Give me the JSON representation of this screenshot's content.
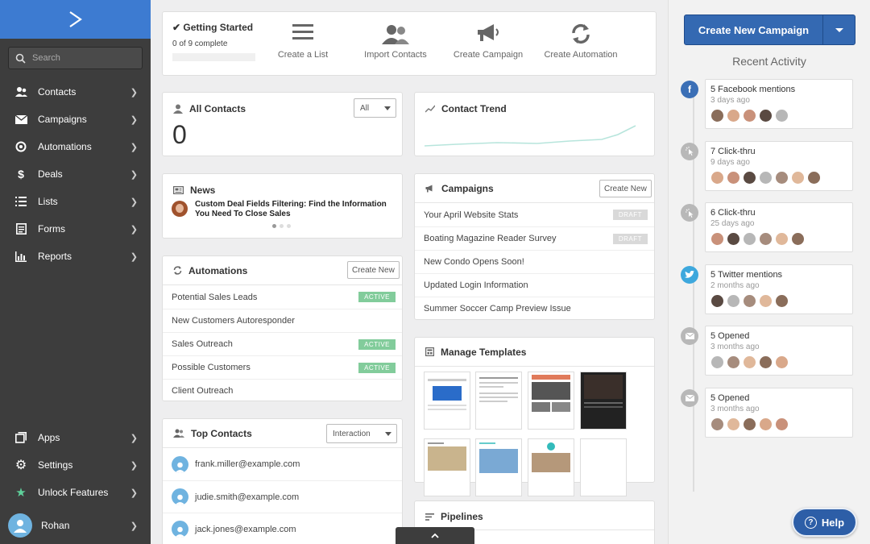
{
  "search": {
    "placeholder": "Search"
  },
  "nav": {
    "contacts": "Contacts",
    "campaigns": "Campaigns",
    "automations": "Automations",
    "deals": "Deals",
    "lists": "Lists",
    "forms": "Forms",
    "reports": "Reports",
    "apps": "Apps",
    "settings": "Settings",
    "unlock": "Unlock Features",
    "user": "Rohan"
  },
  "getting_started": {
    "title": "Getting Started",
    "progress_text": "0 of 9 complete",
    "progress": 0,
    "actions": [
      "Create a List",
      "Import Contacts",
      "Create Campaign",
      "Create Automation"
    ]
  },
  "all_contacts": {
    "title": "All Contacts",
    "filter": "All",
    "count": "0"
  },
  "contact_trend": {
    "title": "Contact Trend"
  },
  "news": {
    "title": "News",
    "headline": "Custom Deal Fields Filtering: Find the Information You Need To Close Sales"
  },
  "automations": {
    "title": "Automations",
    "create_label": "Create New",
    "items": [
      {
        "name": "Potential Sales Leads",
        "status": "ACTIVE"
      },
      {
        "name": "New Customers Autoresponder",
        "status": ""
      },
      {
        "name": "Sales Outreach",
        "status": "ACTIVE"
      },
      {
        "name": "Possible Customers",
        "status": "ACTIVE"
      },
      {
        "name": "Client Outreach",
        "status": ""
      }
    ]
  },
  "campaigns": {
    "title": "Campaigns",
    "create_label": "Create New",
    "items": [
      {
        "name": "Your April Website Stats",
        "status": "DRAFT"
      },
      {
        "name": "Boating Magazine Reader Survey",
        "status": "DRAFT"
      },
      {
        "name": "New Condo Opens Soon!",
        "status": ""
      },
      {
        "name": "Updated Login Information",
        "status": ""
      },
      {
        "name": "Summer Soccer Camp Preview Issue",
        "status": ""
      }
    ]
  },
  "templates": {
    "title": "Manage Templates"
  },
  "top_contacts": {
    "title": "Top Contacts",
    "filter": "Interaction",
    "items": [
      "frank.miller@example.com",
      "judie.smith@example.com",
      "jack.jones@example.com"
    ]
  },
  "pipelines": {
    "title": "Pipelines"
  },
  "right": {
    "create_campaign": "Create New Campaign",
    "recent_title": "Recent Activity",
    "activities": [
      {
        "title": "5 Facebook mentions",
        "time": "3 days ago",
        "icon": "facebook-icon",
        "color": "#3b6fb6",
        "avatars": 5
      },
      {
        "title": "7 Click-thru",
        "time": "9 days ago",
        "icon": "click-icon",
        "color": "#b8b8b8",
        "avatars": 7
      },
      {
        "title": "6 Click-thru",
        "time": "25 days ago",
        "icon": "click-icon",
        "color": "#b8b8b8",
        "avatars": 6
      },
      {
        "title": "5 Twitter mentions",
        "time": "2 months ago",
        "icon": "twitter-icon",
        "color": "#3ea8dd",
        "avatars": 5
      },
      {
        "title": "5 Opened",
        "time": "3 months ago",
        "icon": "envelope-icon",
        "color": "#b8b8b8",
        "avatars": 5
      },
      {
        "title": "5 Opened",
        "time": "3 months ago",
        "icon": "envelope-icon",
        "color": "#b8b8b8",
        "avatars": 5
      }
    ]
  },
  "help": {
    "label": "Help"
  }
}
